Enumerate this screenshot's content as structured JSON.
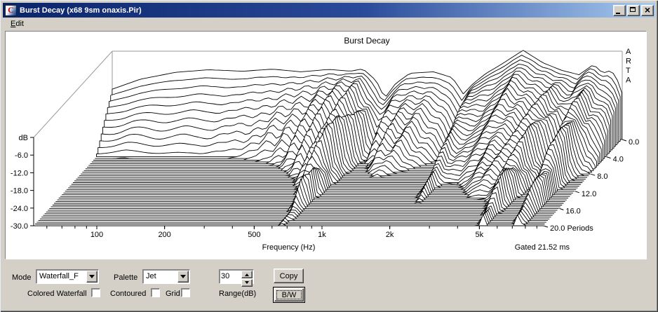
{
  "window": {
    "title": "Burst Decay  (x68 9sm  onaxis.Pir)",
    "icon": "arta-app-icon",
    "icon_letter": "C",
    "buttons": [
      {
        "name": "minimize"
      },
      {
        "name": "maximize"
      },
      {
        "name": "close"
      }
    ]
  },
  "menubar": {
    "items": [
      {
        "label": "Edit"
      }
    ]
  },
  "controls": {
    "mode": {
      "label": "Mode",
      "value": "Waterfall_F"
    },
    "palette": {
      "label": "Palette",
      "value": "Jet"
    },
    "range_db": {
      "label": "Range(dB)",
      "value": "30"
    },
    "copy_label": "Copy",
    "bw_label": "B/W",
    "checkboxes": [
      {
        "label": "Colored Waterfall",
        "checked": false
      },
      {
        "label": "Contoured",
        "checked": false
      },
      {
        "label": "Grid",
        "checked": false
      }
    ]
  },
  "chart_data": {
    "type": "waterfall",
    "title": "Burst Decay",
    "xlabel": "Frequency (Hz)",
    "watermark": "ARTA",
    "gated_label": "Gated 21.52 ms",
    "db_axis": {
      "unit": "dB",
      "tick_labels": [
        "dB",
        "-6.0",
        "-12.0",
        "-18.0",
        "-24.0",
        "-30.0"
      ],
      "tick_values": [
        0,
        -6,
        -12,
        -18,
        -24,
        -30
      ],
      "range": [
        -30,
        0
      ]
    },
    "freq_axis": {
      "range_hz": [
        52.4,
        9600
      ],
      "major_ticks": [
        {
          "hz": 100,
          "label": "100"
        },
        {
          "hz": 200,
          "label": "200"
        },
        {
          "hz": 500,
          "label": "500"
        },
        {
          "hz": 1000,
          "label": "1k"
        },
        {
          "hz": 2000,
          "label": "2k"
        },
        {
          "hz": 5000,
          "label": "5k"
        }
      ],
      "minor_ticks_hz": [
        60,
        70,
        80,
        90,
        100,
        200,
        300,
        400,
        500,
        600,
        700,
        800,
        900,
        1000,
        2000,
        3000,
        4000,
        5000,
        6000,
        7000,
        8000,
        9000
      ]
    },
    "period_axis": {
      "unit": "Periods",
      "range": [
        0,
        20
      ],
      "slices": 51,
      "tick_labels": [
        "0.0",
        "4.0",
        "8.0",
        "12.0",
        "16.0",
        "20.0"
      ],
      "tick_values": [
        0,
        4,
        8,
        12,
        16,
        20
      ]
    },
    "surface_model": {
      "response_db": [
        [
          52,
          -13
        ],
        [
          70,
          -9.5
        ],
        [
          100,
          -7.2
        ],
        [
          140,
          -6.3
        ],
        [
          200,
          -6.8
        ],
        [
          270,
          -6.1
        ],
        [
          360,
          -7.0
        ],
        [
          480,
          -6.2
        ],
        [
          600,
          -6.8
        ],
        [
          680,
          -6.0
        ],
        [
          780,
          -10.0
        ],
        [
          850,
          -16.0
        ],
        [
          950,
          -11.0
        ],
        [
          1100,
          -7.5
        ],
        [
          1400,
          -7.0
        ],
        [
          1700,
          -9.0
        ],
        [
          1900,
          -14.5
        ],
        [
          2100,
          -11.0
        ],
        [
          2400,
          -7.5
        ],
        [
          2800,
          -4.5
        ],
        [
          3500,
          0.3
        ],
        [
          4300,
          -4.0
        ],
        [
          5200,
          -6.5
        ],
        [
          6200,
          -8.0
        ],
        [
          7200,
          -4.5
        ],
        [
          7900,
          -7.5
        ],
        [
          8600,
          -6.5
        ],
        [
          9100,
          -9.0
        ],
        [
          9600,
          -14.0
        ]
      ],
      "decay_db_per_period": [
        [
          52,
          4.0
        ],
        [
          70,
          4.6
        ],
        [
          100,
          5.4
        ],
        [
          150,
          5.6
        ],
        [
          220,
          5.2
        ],
        [
          300,
          4.4
        ],
        [
          400,
          3.2
        ],
        [
          500,
          2.4
        ],
        [
          620,
          1.5
        ],
        [
          680,
          1.05
        ],
        [
          780,
          2.2
        ],
        [
          850,
          3.0
        ],
        [
          950,
          2.6
        ],
        [
          1100,
          2.4
        ],
        [
          1400,
          3.0
        ],
        [
          1700,
          3.6
        ],
        [
          1900,
          4.0
        ],
        [
          2100,
          0.95
        ],
        [
          2300,
          2.0
        ],
        [
          2700,
          2.4
        ],
        [
          3500,
          2.2
        ],
        [
          4300,
          1.8
        ],
        [
          5200,
          1.0
        ],
        [
          5800,
          1.8
        ],
        [
          6300,
          2.4
        ],
        [
          6800,
          1.5
        ],
        [
          7300,
          1.05
        ],
        [
          7700,
          1.1
        ],
        [
          8200,
          2.2
        ],
        [
          8800,
          2.6
        ],
        [
          9600,
          2.2
        ]
      ],
      "ripple": {
        "bumps": [
          {
            "hz": 650,
            "sigma": 0.9,
            "amp": 3.4
          },
          {
            "hz": 5500,
            "sigma": 0.55,
            "amp": 2.2
          }
        ],
        "k": 33.6,
        "phase_per_period": 1.05,
        "broad": {
          "amp": 0.8,
          "k": 13,
          "phase_per_period": 0.6
        }
      }
    }
  }
}
